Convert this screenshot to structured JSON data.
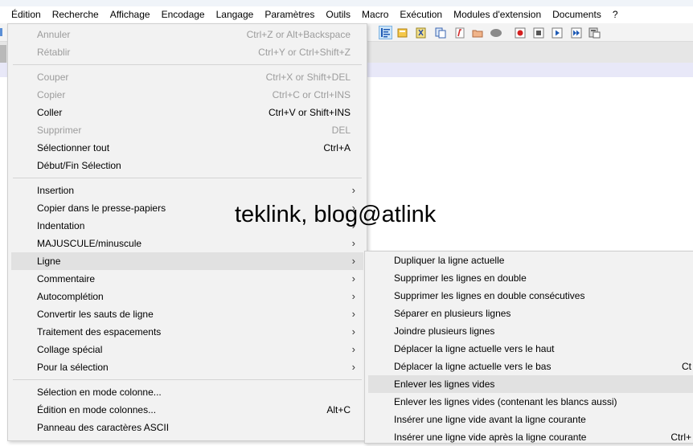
{
  "menubar": {
    "items": [
      "Édition",
      "Recherche",
      "Affichage",
      "Encodage",
      "Langage",
      "Paramètres",
      "Outils",
      "Macro",
      "Exécution",
      "Modules d'extension",
      "Documents",
      "?"
    ]
  },
  "toolbar": {
    "icons": [
      "wrap-icon",
      "notepad-icon",
      "bookmark-icon",
      "document-map-icon",
      "function-list-icon",
      "folder-icon",
      "record-icon",
      "macro-record-icon",
      "macro-stop-icon",
      "macro-play-icon",
      "macro-run-multiple-icon",
      "save-macro-icon"
    ]
  },
  "edit_menu": {
    "annuler": {
      "label": "Annuler",
      "shortcut": "Ctrl+Z or Alt+Backspace"
    },
    "retablir": {
      "label": "Rétablir",
      "shortcut": "Ctrl+Y or Ctrl+Shift+Z"
    },
    "couper": {
      "label": "Couper",
      "shortcut": "Ctrl+X or Shift+DEL"
    },
    "copier": {
      "label": "Copier",
      "shortcut": "Ctrl+C or Ctrl+INS"
    },
    "coller": {
      "label": "Coller",
      "shortcut": "Ctrl+V or Shift+INS"
    },
    "supprimer": {
      "label": "Supprimer",
      "shortcut": "DEL"
    },
    "selectionner_tout": {
      "label": "Sélectionner tout",
      "shortcut": "Ctrl+A"
    },
    "debut_fin": {
      "label": "Début/Fin Sélection"
    },
    "insertion": {
      "label": "Insertion"
    },
    "copier_presse": {
      "label": "Copier dans le presse-papiers"
    },
    "indentation": {
      "label": "Indentation"
    },
    "majuscule": {
      "label": "MAJUSCULE/minuscule"
    },
    "ligne": {
      "label": "Ligne"
    },
    "commentaire": {
      "label": "Commentaire"
    },
    "autocompletion": {
      "label": "Autocomplétion"
    },
    "convertir": {
      "label": "Convertir les sauts de ligne"
    },
    "traitement": {
      "label": "Traitement des espacements"
    },
    "collage": {
      "label": "Collage spécial"
    },
    "pour_selection": {
      "label": "Pour la sélection"
    },
    "mode_colonne": {
      "label": "Sélection en mode colonne..."
    },
    "edition_colonnes": {
      "label": "Édition en mode colonnes...",
      "shortcut": "Alt+C"
    },
    "panneau_ascii": {
      "label": "Panneau des caractères ASCII"
    },
    "arrow": "›"
  },
  "ligne_submenu": {
    "items": [
      {
        "label": "Dupliquer la ligne actuelle",
        "shortcut": ""
      },
      {
        "label": "Supprimer les lignes en double",
        "shortcut": ""
      },
      {
        "label": "Supprimer les lignes en double consécutives",
        "shortcut": ""
      },
      {
        "label": "Séparer en plusieurs lignes",
        "shortcut": ""
      },
      {
        "label": "Joindre plusieurs lignes",
        "shortcut": ""
      },
      {
        "label": "Déplacer la ligne actuelle vers le haut",
        "shortcut": ""
      },
      {
        "label": "Déplacer la ligne actuelle vers le bas",
        "shortcut": "Ct"
      },
      {
        "label": "Enlever les lignes vides",
        "shortcut": ""
      },
      {
        "label": "Enlever les lignes vides (contenant les blancs aussi)",
        "shortcut": ""
      },
      {
        "label": "Insérer une ligne vide avant la ligne courante",
        "shortcut": ""
      },
      {
        "label": "Insérer une ligne vide après la ligne courante",
        "shortcut": "Ctrl+"
      }
    ]
  },
  "watermark": "teklink, blog@atlink",
  "colors": {
    "menu_bg": "#f2f2f2",
    "highlight": "#e1e1e1",
    "disabled": "#9c9c9c",
    "toolbar_active": "#cce4f7"
  }
}
